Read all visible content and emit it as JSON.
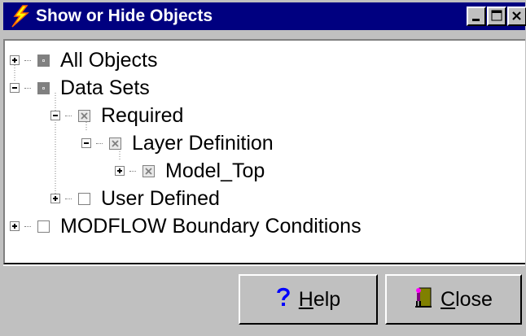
{
  "window": {
    "title": "Show or Hide Objects",
    "title_icon": "lightning-bolt-icon"
  },
  "tree": {
    "items": [
      {
        "label": "All Objects",
        "expander": "plus",
        "check": "grey"
      },
      {
        "label": "Data Sets",
        "expander": "minus",
        "check": "grey"
      },
      {
        "label": "Required",
        "expander": "minus",
        "check": "partial"
      },
      {
        "label": "Layer Definition",
        "expander": "minus",
        "check": "partial"
      },
      {
        "label": "Model_Top",
        "expander": "plus",
        "check": "partial"
      },
      {
        "label": "User Defined",
        "expander": "plus",
        "check": "unchecked"
      },
      {
        "label": "MODFLOW Boundary Conditions",
        "expander": "plus",
        "check": "unchecked"
      }
    ]
  },
  "buttons": {
    "help": {
      "mnemonic": "H",
      "rest": "elp",
      "icon": "question-mark-icon"
    },
    "close": {
      "mnemonic": "C",
      "rest": "lose",
      "icon": "door-exit-icon"
    }
  }
}
